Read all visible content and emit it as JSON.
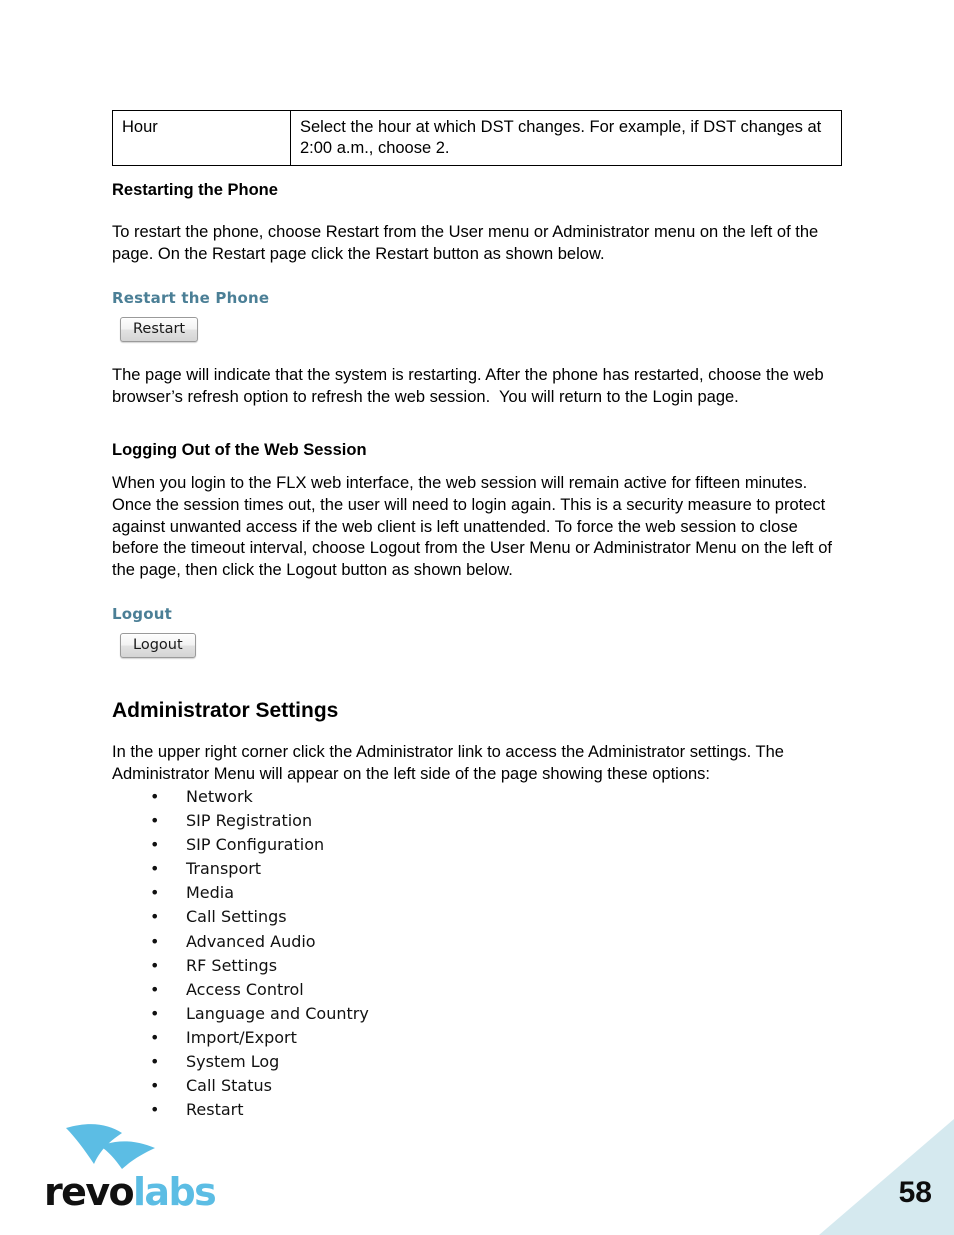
{
  "document": {
    "page_number": "58",
    "logo": {
      "word_part_1": "revo",
      "word_part_2": "labs",
      "bird_icon": "bird-swoosh-icon",
      "brand_blue": "#5cbde4",
      "corner_blue": "#d5e9ef"
    }
  },
  "param_table": {
    "rows": [
      {
        "name": "Hour",
        "description": "Select the hour at which DST changes. For example, if DST changes at 2:00 a.m., choose 2."
      }
    ]
  },
  "sections": {
    "restarting": {
      "heading": "Restarting the Phone",
      "paragraph": "To restart the phone, choose Restart from the User menu or Administrator menu on the left of the page. On the Restart page click the Restart button as shown below.",
      "screenshot": {
        "title": "Restart the Phone",
        "button_label": "Restart"
      },
      "after_paragraph": "The page will indicate that the system is restarting. After the phone has restarted, choose the web browser’s refresh option to refresh the web session.  You will return to the Login page."
    },
    "logging_out": {
      "heading": "Logging Out of the Web Session",
      "paragraph": "When you login to the FLX web interface, the web session will remain active for fifteen minutes. Once the session times out, the user will need to login again. This is a security measure to protect against unwanted access if the web client is left unattended. To force the web session to close before the timeout interval, choose Logout from the User Menu or Administrator Menu on the left of the page, then click the Logout button as shown below.",
      "screenshot": {
        "title": "Logout",
        "button_label": "Logout"
      }
    },
    "administrator_settings": {
      "heading": "Administrator Settings",
      "paragraph": "In the upper right corner click the Administrator link to access the Administrator settings. The Administrator Menu will appear on the left side of the page showing these options:",
      "options": [
        "Network",
        "SIP Registration",
        "SIP Configuration",
        "Transport",
        "Media",
        "Call Settings",
        "Advanced Audio",
        "RF Settings",
        "Access Control",
        "Language and Country",
        "Import/Export",
        "System Log",
        "Call Status",
        "Restart"
      ]
    }
  }
}
